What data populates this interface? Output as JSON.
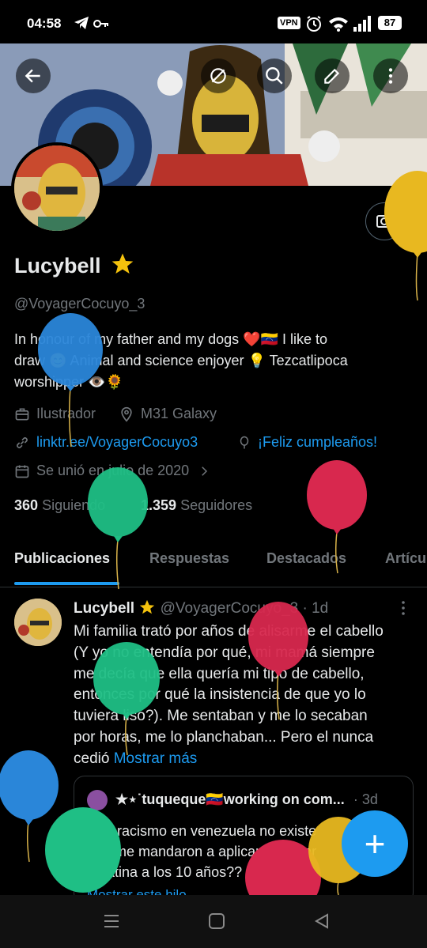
{
  "status_bar": {
    "time": "04:58",
    "vpn": "VPN",
    "battery": "87"
  },
  "profile": {
    "name": "Lucybell",
    "handle": "@VoyagerCocuyo_3",
    "bio_line1": "In honour of my father and my dogs ❤️🇻🇪  I like to",
    "bio_line2": "draw 😊 Animal and science enjoyer 💡 Tezcatlipoca",
    "bio_line3": "worshipper 👁️🌻",
    "job": "Ilustrador",
    "location": "M31 Galaxy",
    "website": "linktr.ee/VoyagerCocuyo3",
    "birthday": "¡Feliz cumpleaños!",
    "joined": "Se unió en julio de 2020",
    "following_count": "360",
    "following_label": "Siguiendo",
    "followers_count": "1.359",
    "followers_label": "Seguidores"
  },
  "tabs": [
    {
      "label": "Publicaciones"
    },
    {
      "label": "Respuestas"
    },
    {
      "label": "Destacados"
    },
    {
      "label": "Artícu"
    }
  ],
  "post": {
    "author": "Lucybell",
    "handle_time": "@VoyagerCocuyo_3 · 1d",
    "lines": [
      "Mi familia trató por años de alisarme el cabello",
      "(Y yo no entendía por qué, mi mamá siempre",
      "me decía que ella quería mi tipo de cabello,",
      "entonces por qué la insistencia de que yo lo",
      "tuviera liso?). Me sentaban y me lo secaban",
      "por horas, me lo planchaban... Pero el nunca"
    ],
    "last_line": "cedió",
    "show_more": "Mostrar más",
    "quote": {
      "author": "★⋆˙tuqueque🇻🇪working on com...",
      "time": "· 3d",
      "line1": "sí el racismo en venezuela no existe",
      "line2": "qué me mandaron a aplicarme mí pr",
      "line3": "keratina a los 10 años??",
      "show_thread": "Mostrar este hilo"
    }
  },
  "fab": {
    "label": "+"
  },
  "colors": {
    "accent": "#1d9bf0",
    "background": "#000000",
    "text": "#e7e9ea",
    "muted": "#71767b",
    "star": "#f4c20d"
  },
  "icons": [
    "back-arrow-icon",
    "no-notifications-icon",
    "search-icon",
    "share-icon",
    "more-vertical-icon",
    "camera-lens-icon",
    "star-icon",
    "briefcase-icon",
    "location-pin-icon",
    "link-icon",
    "balloon-icon",
    "calendar-icon",
    "chevron-right-icon"
  ]
}
